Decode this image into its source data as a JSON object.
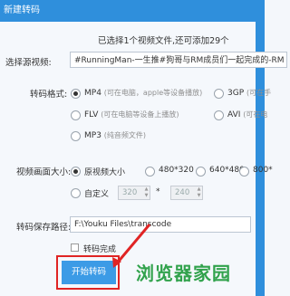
{
  "window": {
    "title": "新建转码"
  },
  "info_text": "已选择1个视频文件,还可添加29个",
  "source": {
    "label": "选择源视频:",
    "value": "#RunningMan-一生推#狗哥与RM成员们一起完成的-RM"
  },
  "format": {
    "label": "转码格式:",
    "options": [
      {
        "name": "MP4",
        "note": "(可在电脑，apple等设备播放)",
        "selected": true
      },
      {
        "name": "3GP",
        "note": "(可在手",
        "selected": false
      },
      {
        "name": "FLV",
        "note": "(可在电脑等设备上播放)",
        "selected": false
      },
      {
        "name": "AVI",
        "note": "(可在电",
        "selected": false
      },
      {
        "name": "MP3",
        "note": "(纯音频文件)",
        "selected": false
      }
    ]
  },
  "size": {
    "label": "视频画面大小:",
    "options": [
      {
        "name": "原视频大小",
        "selected": true
      },
      {
        "name": "480*320",
        "selected": false
      },
      {
        "name": "640*480",
        "selected": false
      },
      {
        "name": "800*",
        "selected": false
      }
    ],
    "custom_label": "自定义",
    "width_value": "320",
    "times": "*",
    "height_value": "240"
  },
  "save": {
    "label": "转码保存路径:",
    "value": "F:\\Youku Files\\transcode"
  },
  "checkbox_label": "转码完成",
  "start_button": "开始转码",
  "watermark": "浏览器家园"
}
